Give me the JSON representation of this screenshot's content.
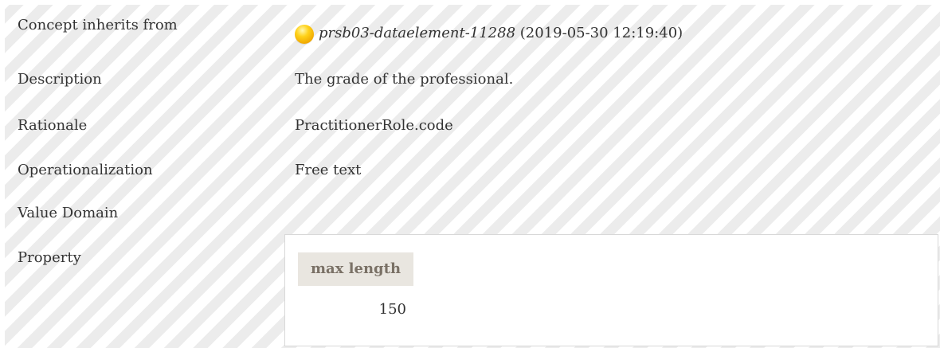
{
  "concept": {
    "inherits_label": "Concept inherits from",
    "inherits_ref": "prsb03-dataelement-11288",
    "inherits_timestamp": "(2019-05-30 12:19:40)",
    "status_color": "#ffc600",
    "description_label": "Description",
    "description_value": "The grade of the professional.",
    "rationale_label": "Rationale",
    "rationale_value": "PractitionerRole.code",
    "operationalization_label": "Operationalization",
    "operationalization_value": "Free text",
    "value_domain_label": "Value Domain",
    "property_label": "Property",
    "property": {
      "header": "max length",
      "value": "150"
    }
  }
}
